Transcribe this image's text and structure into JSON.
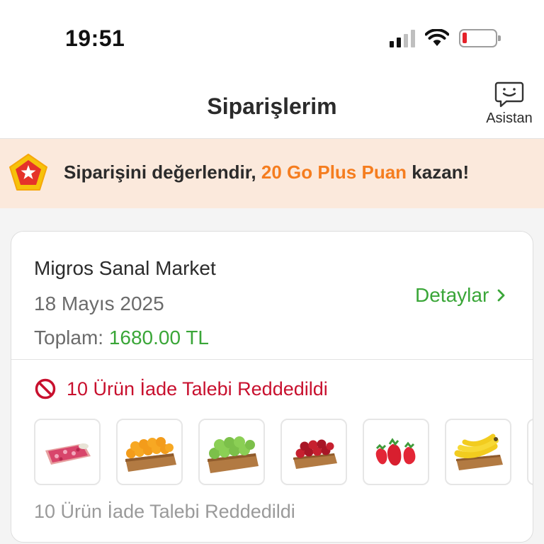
{
  "status_bar": {
    "time": "19:51",
    "cellular_icon": "cellular-signal-icon",
    "wifi_icon": "wifi-icon",
    "battery_icon": "battery-low-icon",
    "battery_color": "#e5222a"
  },
  "nav": {
    "title": "Siparişlerim",
    "assistant_label": "Asistan",
    "assistant_icon": "chat-assistant-icon"
  },
  "promo": {
    "text_prefix": "Siparişini değerlendir, ",
    "highlight": "20 Go Plus Puan",
    "text_suffix": " kazan!",
    "badge_icon": "star-badge-icon",
    "highlight_color": "#f57d1f"
  },
  "order": {
    "store": "Migros Sanal Market",
    "date": "18 Mayıs 2025",
    "total_label": "Toplam: ",
    "total_value": "1680.00 TL",
    "details_label": "Detaylar",
    "details_icon": "chevron-right-icon",
    "refund_status": "10 Ürün İade Talebi Reddedildi",
    "refund_icon": "prohibited-icon",
    "refund_footer": "10 Ürün İade Talebi Reddedildi",
    "products": [
      {
        "name": "ground-meat",
        "icon": "ground-meat-icon"
      },
      {
        "name": "oranges",
        "icon": "oranges-crate-icon"
      },
      {
        "name": "green-apples",
        "icon": "green-apples-crate-icon"
      },
      {
        "name": "red-apples",
        "icon": "red-apples-crate-icon"
      },
      {
        "name": "strawberries",
        "icon": "strawberries-icon"
      },
      {
        "name": "bananas",
        "icon": "bananas-crate-icon"
      }
    ]
  },
  "colors": {
    "green": "#3aa638",
    "red": "#c8102e",
    "orange": "#f57d1f",
    "banner_bg": "#fbe9dc"
  }
}
